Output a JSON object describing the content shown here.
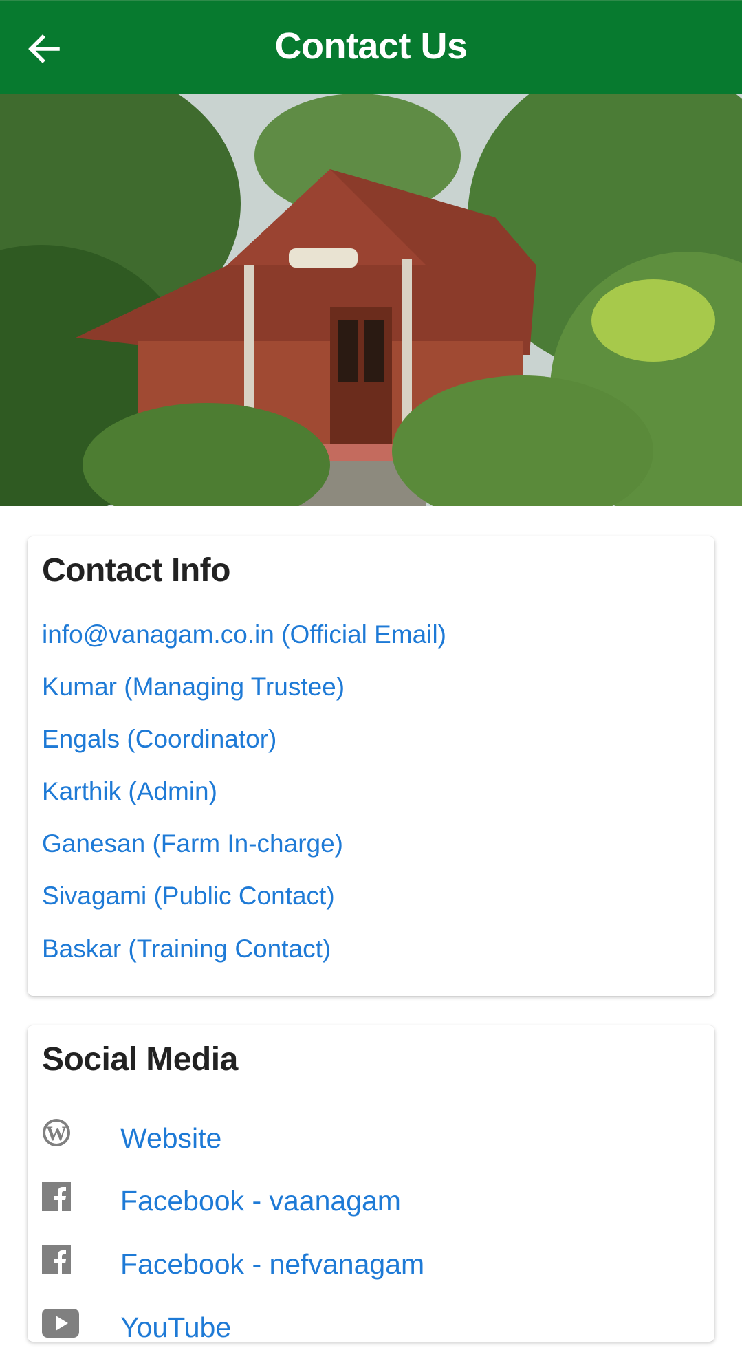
{
  "appbar": {
    "title": "Contact Us",
    "back_icon": "arrow-left-icon",
    "bg_color": "#077a2f"
  },
  "hero": {
    "description": "Photo of a red wooden cottage with tiled roof surrounded by trees"
  },
  "contact_info": {
    "heading": "Contact Info",
    "items": [
      {
        "label": "info@vanagam.co.in (Official Email)"
      },
      {
        "label": "Kumar (Managing Trustee)"
      },
      {
        "label": "Engals (Coordinator)"
      },
      {
        "label": "Karthik (Admin)"
      },
      {
        "label": "Ganesan (Farm In-charge)"
      },
      {
        "label": "Sivagami (Public Contact)"
      },
      {
        "label": "Baskar (Training Contact)"
      }
    ]
  },
  "social_media": {
    "heading": "Social Media",
    "items": [
      {
        "icon": "wordpress-icon",
        "label": "Website"
      },
      {
        "icon": "facebook-icon",
        "label": "Facebook - vaanagam"
      },
      {
        "icon": "facebook-icon",
        "label": "Facebook - nefvanagam"
      },
      {
        "icon": "youtube-icon",
        "label": "YouTube"
      }
    ]
  },
  "colors": {
    "link": "#1e7ad6",
    "heading": "#222222",
    "icon_gray": "#808080"
  }
}
